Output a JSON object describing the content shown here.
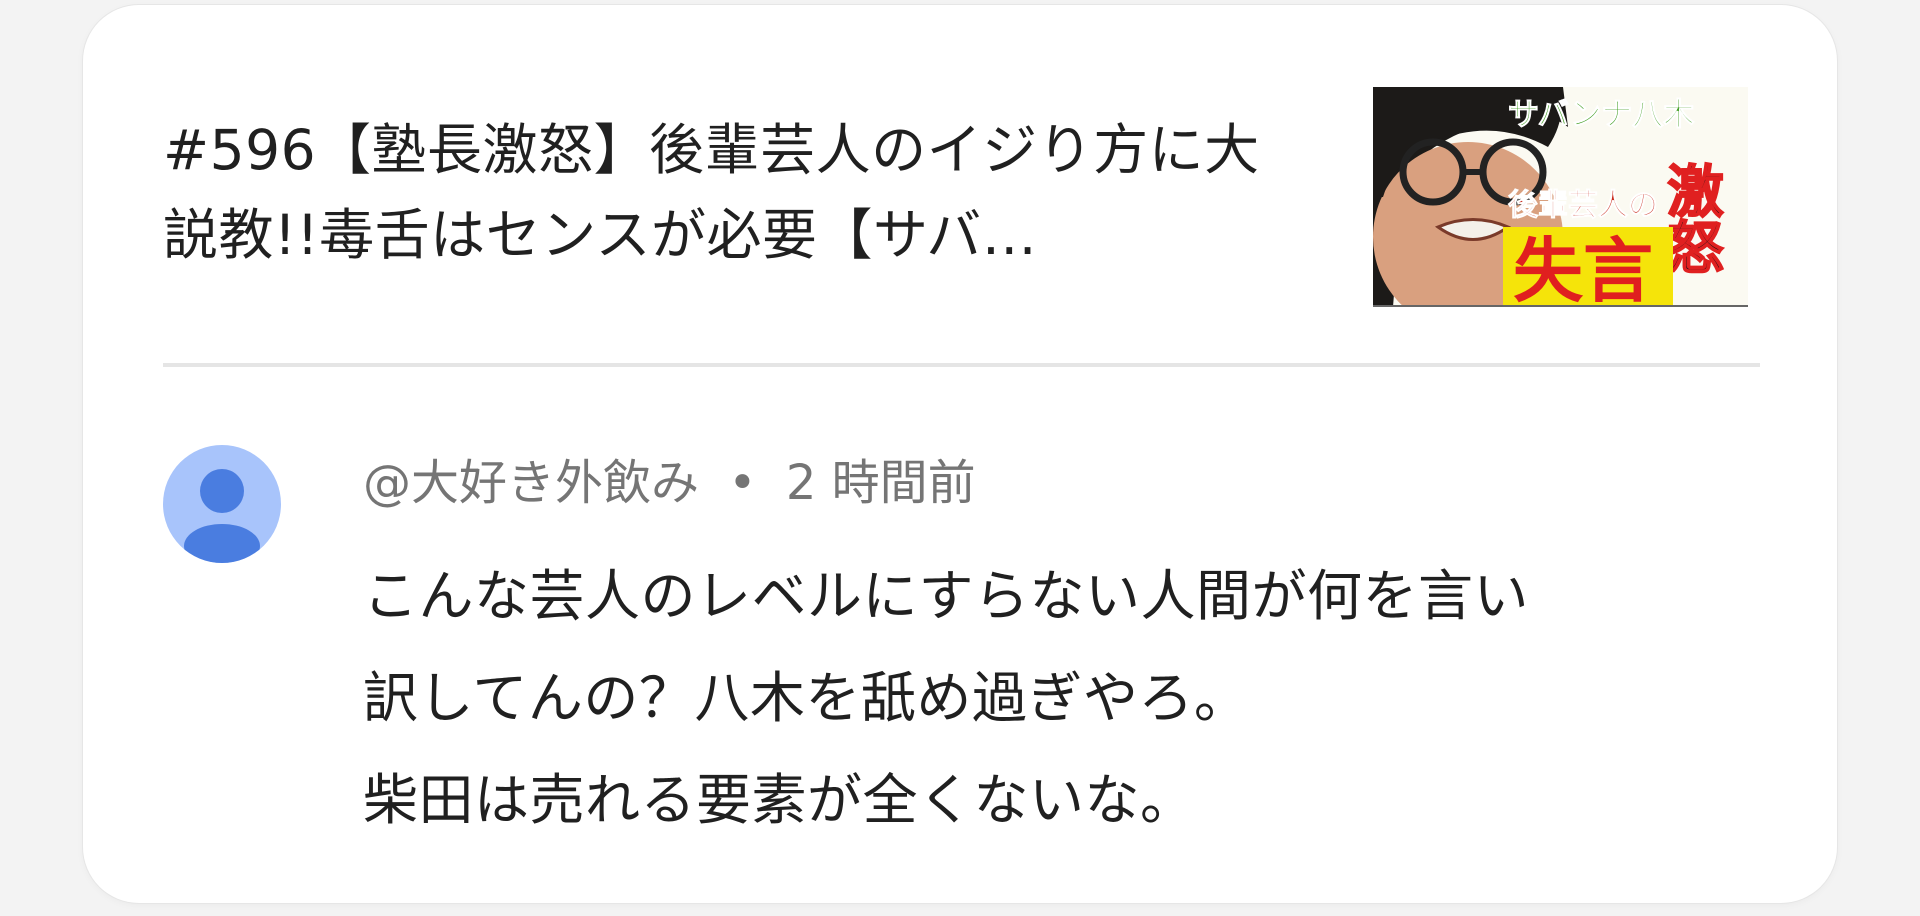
{
  "video": {
    "title": "#596【塾長激怒】後輩芸人のイジり方に大説教!!毒舌はセンスが必要【サバ…",
    "thumbnail": {
      "text_top": "サバンナ八木",
      "text_side": "激怒",
      "text_middle": "後輩芸人の",
      "text_big": "失言"
    }
  },
  "comment": {
    "author": "@大好き外飲み",
    "separator": "•",
    "time": "2 時間前",
    "lines": [
      "こんな芸人のレベルにすらない人間が何を言い",
      "訳してんの？八木を舐め過ぎやろ。",
      "柴田は売れる要素が全くないな。"
    ]
  },
  "colors": {
    "avatar_bg": "#a8c4fb",
    "avatar_fg": "#4a7de0",
    "divider": "#e5e5e5",
    "meta_text": "#757575",
    "main_text": "#202020"
  }
}
